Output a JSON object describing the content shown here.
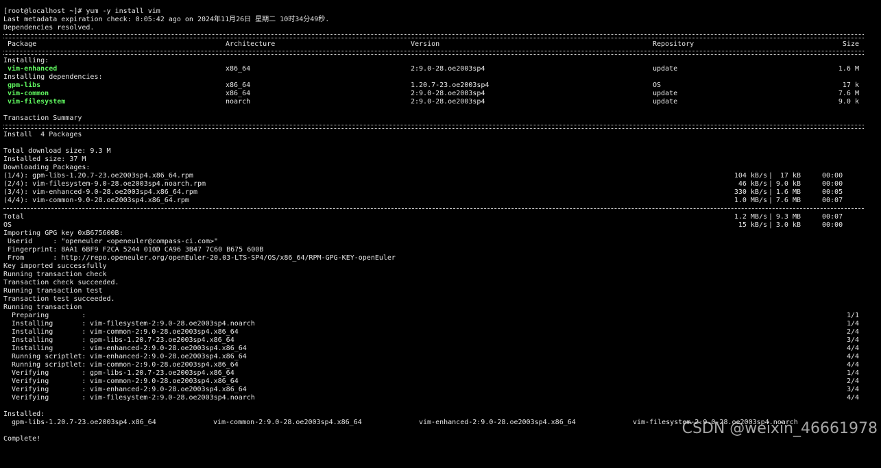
{
  "terminal": {
    "prompt": "[root@localhost ~]# yum -y install vim",
    "metadata": "Last metadata expiration check: 0:05:42 ago on 2024年11月26日 星期二 10时34分49秒.",
    "deps_resolved": "Dependencies resolved.",
    "headers": {
      "package": "Package",
      "arch": "Architecture",
      "version": "Version",
      "repo": "Repository",
      "size": "Size"
    },
    "installing_label": "Installing:",
    "installing": [
      {
        "name": "vim-enhanced",
        "arch": "x86_64",
        "version": "2:9.0-28.oe2003sp4",
        "repo": "update",
        "size": "1.6 M"
      }
    ],
    "deps_label": "Installing dependencies:",
    "dependencies": [
      {
        "name": "gpm-libs",
        "arch": "x86_64",
        "version": "1.20.7-23.oe2003sp4",
        "repo": "OS",
        "size": "17 k"
      },
      {
        "name": "vim-common",
        "arch": "x86_64",
        "version": "2:9.0-28.oe2003sp4",
        "repo": "update",
        "size": "7.6 M"
      },
      {
        "name": "vim-filesystem",
        "arch": "noarch",
        "version": "2:9.0-28.oe2003sp4",
        "repo": "update",
        "size": "9.0 k"
      }
    ],
    "summary_title": "Transaction Summary",
    "install_count": "Install  4 Packages",
    "download_size": "Total download size: 9.3 M",
    "installed_size": "Installed size: 37 M",
    "downloading": "Downloading Packages:",
    "downloads": [
      {
        "file": "(1/4): gpm-libs-1.20.7-23.oe2003sp4.x86_64.rpm",
        "rate": "104 kB/s",
        "size": " 17 kB",
        "time": "00:00"
      },
      {
        "file": "(2/4): vim-filesystem-9.0-28.oe2003sp4.noarch.rpm",
        "rate": "46 kB/s",
        "size": "9.0 kB",
        "time": "00:00"
      },
      {
        "file": "(3/4): vim-enhanced-9.0-28.oe2003sp4.x86_64.rpm",
        "rate": "330 kB/s",
        "size": "1.6 MB",
        "time": "00:05"
      },
      {
        "file": "(4/4): vim-common-9.0-28.oe2003sp4.x86_64.rpm",
        "rate": "1.0 MB/s",
        "size": "7.6 MB",
        "time": "00:07"
      }
    ],
    "totals": [
      {
        "label": "Total",
        "rate": "1.2 MB/s",
        "size": "9.3 MB",
        "time": "00:07"
      },
      {
        "label": "OS",
        "rate": "15 kB/s",
        "size": "3.0 kB",
        "time": "00:00"
      }
    ],
    "gpg_lines": [
      "Importing GPG key 0xB675600B:",
      " Userid     : \"openeuler <openeuler@compass-ci.com>\"",
      " Fingerprint: 8AA1 6BF9 F2CA 5244 010D CA96 3B47 7C60 B675 600B",
      " From       : http://repo.openeuler.org/openEuler-20.03-LTS-SP4/OS/x86_64/RPM-GPG-KEY-openEuler",
      "Key imported successfully",
      "Running transaction check",
      "Transaction check succeeded.",
      "Running transaction test",
      "Transaction test succeeded.",
      "Running transaction"
    ],
    "steps": [
      {
        "action": "  Preparing        :",
        "detail": "",
        "count": "1/1"
      },
      {
        "action": "  Installing       :",
        "detail": "vim-filesystem-2:9.0-28.oe2003sp4.noarch",
        "count": "1/4"
      },
      {
        "action": "  Installing       :",
        "detail": "vim-common-2:9.0-28.oe2003sp4.x86_64",
        "count": "2/4"
      },
      {
        "action": "  Installing       :",
        "detail": "gpm-libs-1.20.7-23.oe2003sp4.x86_64",
        "count": "3/4"
      },
      {
        "action": "  Installing       :",
        "detail": "vim-enhanced-2:9.0-28.oe2003sp4.x86_64",
        "count": "4/4"
      },
      {
        "action": "  Running scriptlet:",
        "detail": "vim-enhanced-2:9.0-28.oe2003sp4.x86_64",
        "count": "4/4"
      },
      {
        "action": "  Running scriptlet:",
        "detail": "vim-common-2:9.0-28.oe2003sp4.x86_64",
        "count": "4/4"
      },
      {
        "action": "  Verifying        :",
        "detail": "gpm-libs-1.20.7-23.oe2003sp4.x86_64",
        "count": "1/4"
      },
      {
        "action": "  Verifying        :",
        "detail": "vim-common-2:9.0-28.oe2003sp4.x86_64",
        "count": "2/4"
      },
      {
        "action": "  Verifying        :",
        "detail": "vim-enhanced-2:9.0-28.oe2003sp4.x86_64",
        "count": "3/4"
      },
      {
        "action": "  Verifying        :",
        "detail": "vim-filesystem-2:9.0-28.oe2003sp4.noarch",
        "count": "4/4"
      }
    ],
    "installed_label": "Installed:",
    "installed": [
      "gpm-libs-1.20.7-23.oe2003sp4.x86_64",
      "vim-common-2:9.0-28.oe2003sp4.x86_64",
      "vim-enhanced-2:9.0-28.oe2003sp4.x86_64",
      "vim-filesystem-2:9.0-28.oe2003sp4.noarch"
    ],
    "complete": "Complete!"
  },
  "watermark": "CSDN @weixin_46661978",
  "colors": {
    "background": "#000000",
    "text": "#e6e6e6",
    "package_highlight": "#5ff55f"
  }
}
